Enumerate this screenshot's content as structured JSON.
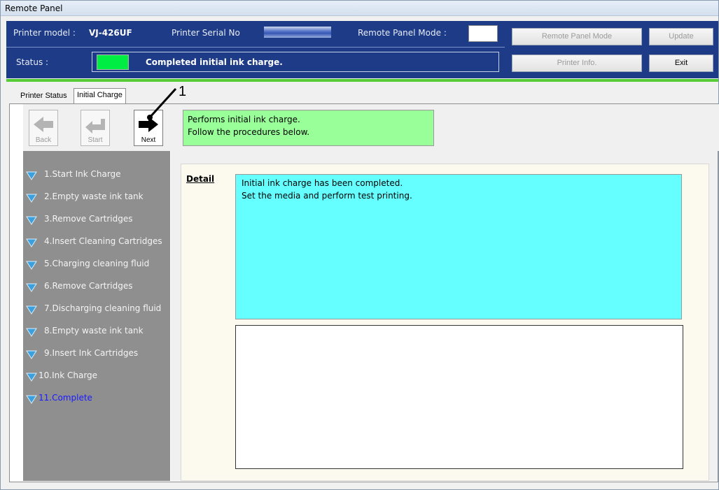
{
  "window": {
    "title": "Remote Panel"
  },
  "header": {
    "model_label": "Printer model :",
    "model_value": "VJ-426UF",
    "serial_label": "Printer Serial No",
    "mode_label": "Remote Panel Mode :",
    "status_label": "Status :",
    "status_text": "Completed initial ink charge.",
    "status_color": "#00ee44"
  },
  "buttons": {
    "remote_panel_mode": "Remote Panel Mode",
    "update": "Update",
    "printer_info": "Printer Info.",
    "exit": "Exit"
  },
  "tabs": [
    {
      "label": "Printer Status"
    },
    {
      "label": "Initial Charge"
    }
  ],
  "toolbar": {
    "back": "Back",
    "start": "Start",
    "next": "Next",
    "message_line1": "Performs initial ink charge.",
    "message_line2": "Follow the procedures below."
  },
  "steps": [
    {
      "label": "1.Start Ink Charge"
    },
    {
      "label": "2.Empty waste ink tank"
    },
    {
      "label": "3.Remove Cartridges"
    },
    {
      "label": "4.Insert Cleaning Cartridges"
    },
    {
      "label": "5.Charging cleaning fluid"
    },
    {
      "label": "6.Remove Cartridges"
    },
    {
      "label": "7.Discharging cleaning fluid"
    },
    {
      "label": "8.Empty waste ink tank"
    },
    {
      "label": "9.Insert Ink Cartridges"
    },
    {
      "label": "10.Ink Charge"
    },
    {
      "label": "11.Complete"
    }
  ],
  "detail": {
    "label": "Detail",
    "line1": "Initial ink charge has been completed.",
    "line2": "Set the media and perform test printing."
  },
  "callout": {
    "number": "1"
  }
}
